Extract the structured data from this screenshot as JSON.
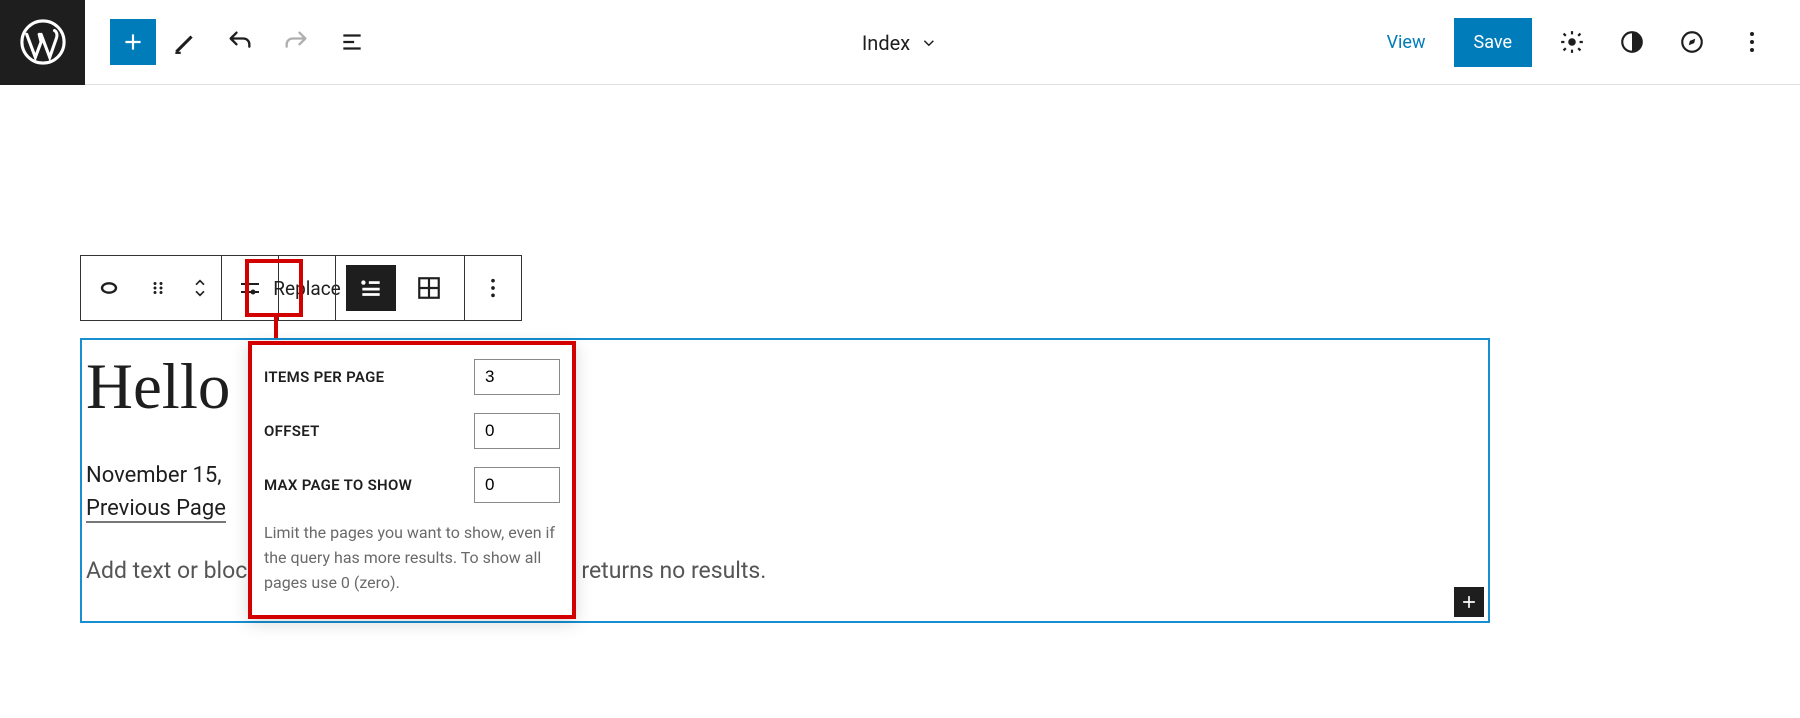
{
  "header": {
    "template_label": "Index",
    "view_label": "View",
    "save_label": "Save"
  },
  "block_toolbar": {
    "replace_label": "Replace"
  },
  "popover": {
    "items_per_page": {
      "label": "ITEMS PER PAGE",
      "value": "3"
    },
    "offset": {
      "label": "OFFSET",
      "value": "0"
    },
    "max_page": {
      "label": "MAX PAGE TO SHOW",
      "value": "0"
    },
    "help_text": "Limit the pages you want to show, even if the query has more results. To show all pages use 0 (zero)."
  },
  "content": {
    "heading": "Hello",
    "date": "November 15,",
    "pager_prev": "Previous Page",
    "no_results_placeholder": "Add text or blocks that will display when a query returns no results."
  }
}
